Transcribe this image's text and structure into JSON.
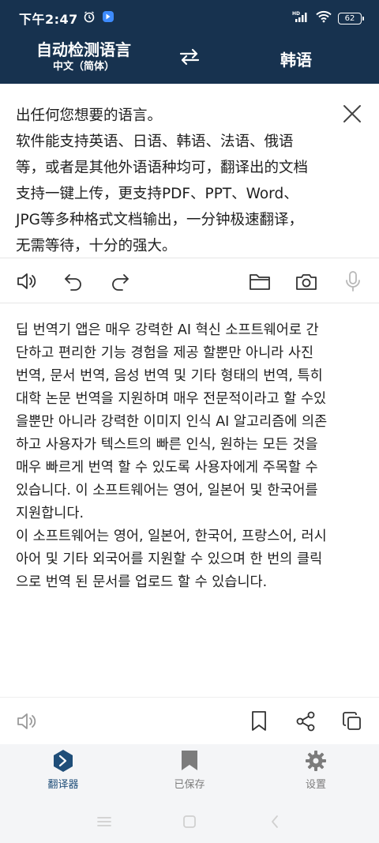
{
  "status": {
    "time": "下午2:47",
    "battery": "62",
    "network": "HD"
  },
  "lang": {
    "source": "自动检测语言",
    "source_sub": "中文（简体）",
    "target": "韩语"
  },
  "source_text": "出任何您想要的语言。\n软件能支持英语、日语、韩语、法语、俄语\n等，或者是其他外语语种均可，翻译出的文档\n支持一键上传，更支持PDF、PPT、Word、\nJPG等多种格式文档输出，一分钟极速翻译，\n无需等待，十分的强大。",
  "target_text": "딥 번역기 앱은 매우 강력한 AI 혁신 소프트웨어로 간\n단하고 편리한 기능 경험을 제공 할뿐만 아니라 사진\n번역, 문서 번역, 음성 번역 및 기타 형태의 번역, 특히\n대학 논문 번역을 지원하며 매우 전문적이라고 할 수있\n을뿐만 아니라 강력한 이미지 인식 AI 알고리즘에 의존\n하고 사용자가 텍스트의 빠른 인식, 원하는 모든 것을\n매우 빠르게 번역 할 수 있도록 사용자에게 주목할 수\n있습니다. 이 소프트웨어는 영어, 일본어 및 한국어를\n지원합니다.\n이 소프트웨어는 영어, 일본어, 한국어, 프랑스어, 러시\n아어 및 기타 외국어를 지원할 수 있으며 한 번의 클릭\n으로 번역 된 문서를 업로드 할 수 있습니다.",
  "nav": {
    "translator": "翻译器",
    "saved": "已保存",
    "settings": "设置"
  },
  "colors": {
    "header": "#17324f",
    "active_nav": "#1f4e79",
    "inactive_nav": "#7c7c7c"
  }
}
